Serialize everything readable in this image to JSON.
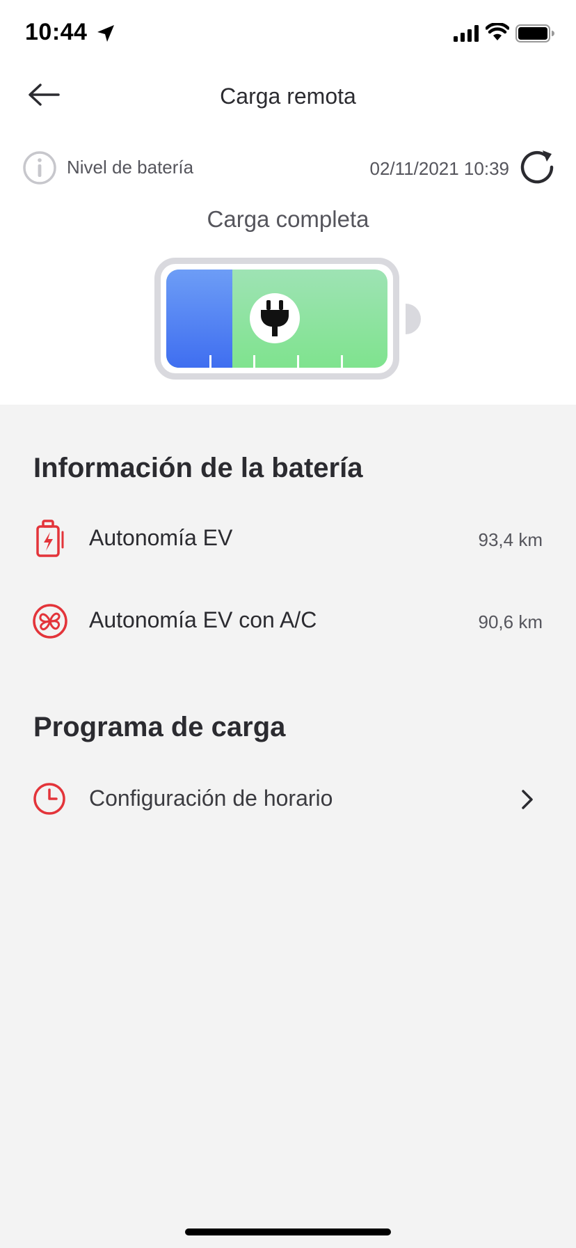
{
  "status_bar": {
    "time": "10:44"
  },
  "header": {
    "title": "Carga remota"
  },
  "battery_level": {
    "label": "Nivel de batería",
    "timestamp": "02/11/2021 10:39",
    "status": "Carga completa",
    "level_fraction": 0.3,
    "plugged_in": true
  },
  "battery_info": {
    "title": "Información de la batería",
    "items": [
      {
        "label": "Autonomía EV",
        "value": "93,4 km",
        "icon": "battery-charge-icon"
      },
      {
        "label": "Autonomía EV con A/C",
        "value": "90,6 km",
        "icon": "fan-icon"
      }
    ]
  },
  "charge_program": {
    "title": "Programa de carga",
    "items": [
      {
        "label": "Configuración de horario",
        "icon": "clock-icon"
      }
    ]
  },
  "colors": {
    "accent_red": "#e3343a",
    "battery_blue": "#3f6ef0",
    "battery_green": "#7fe38e",
    "text_dark": "#2b2b30",
    "text_gray": "#55555c",
    "background": "#f3f3f3"
  }
}
